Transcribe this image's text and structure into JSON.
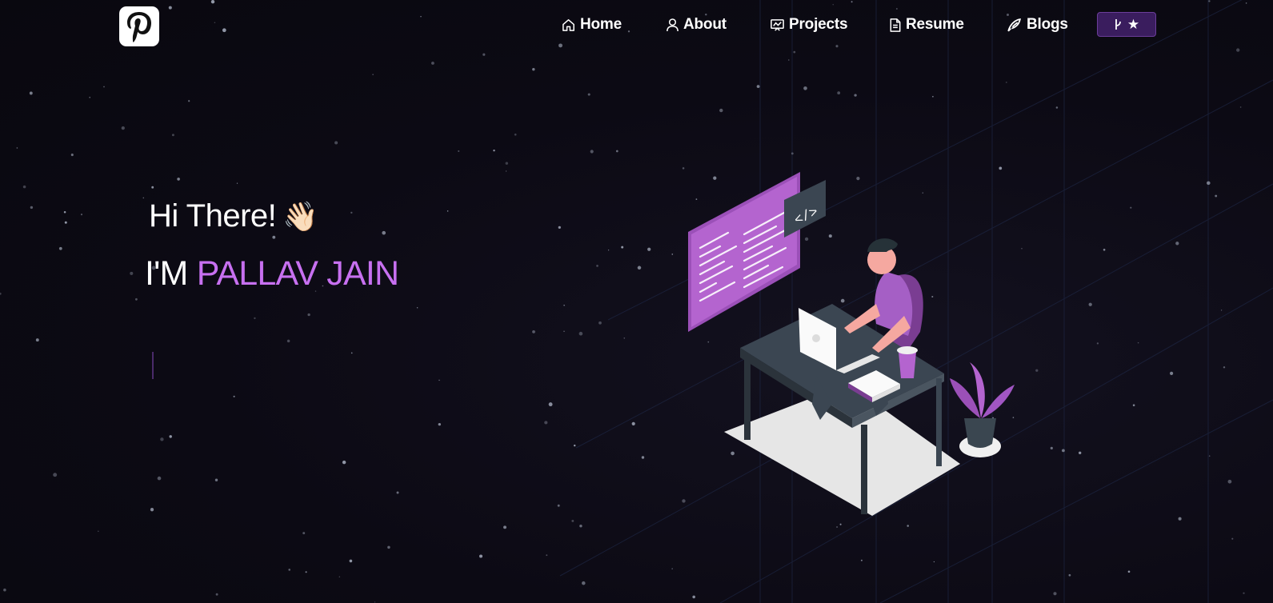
{
  "nav": {
    "logo_icon": "p-logo-icon",
    "items": [
      {
        "label": "Home",
        "icon": "home-icon"
      },
      {
        "label": "About",
        "icon": "user-icon"
      },
      {
        "label": "Projects",
        "icon": "projects-icon"
      },
      {
        "label": "Resume",
        "icon": "document-icon"
      },
      {
        "label": "Blogs",
        "icon": "blog-icon"
      }
    ],
    "github_button": {
      "icons": [
        "fork-icon",
        "star-icon"
      ],
      "bg_color": "#3a1d5e"
    }
  },
  "hero": {
    "greeting": "Hi There!",
    "greeting_emoji": "👋🏻",
    "name_prefix": "I'M",
    "name": "PALLAV JAIN",
    "accent_color": "#c770f0",
    "illustration_code_label": "</>"
  }
}
